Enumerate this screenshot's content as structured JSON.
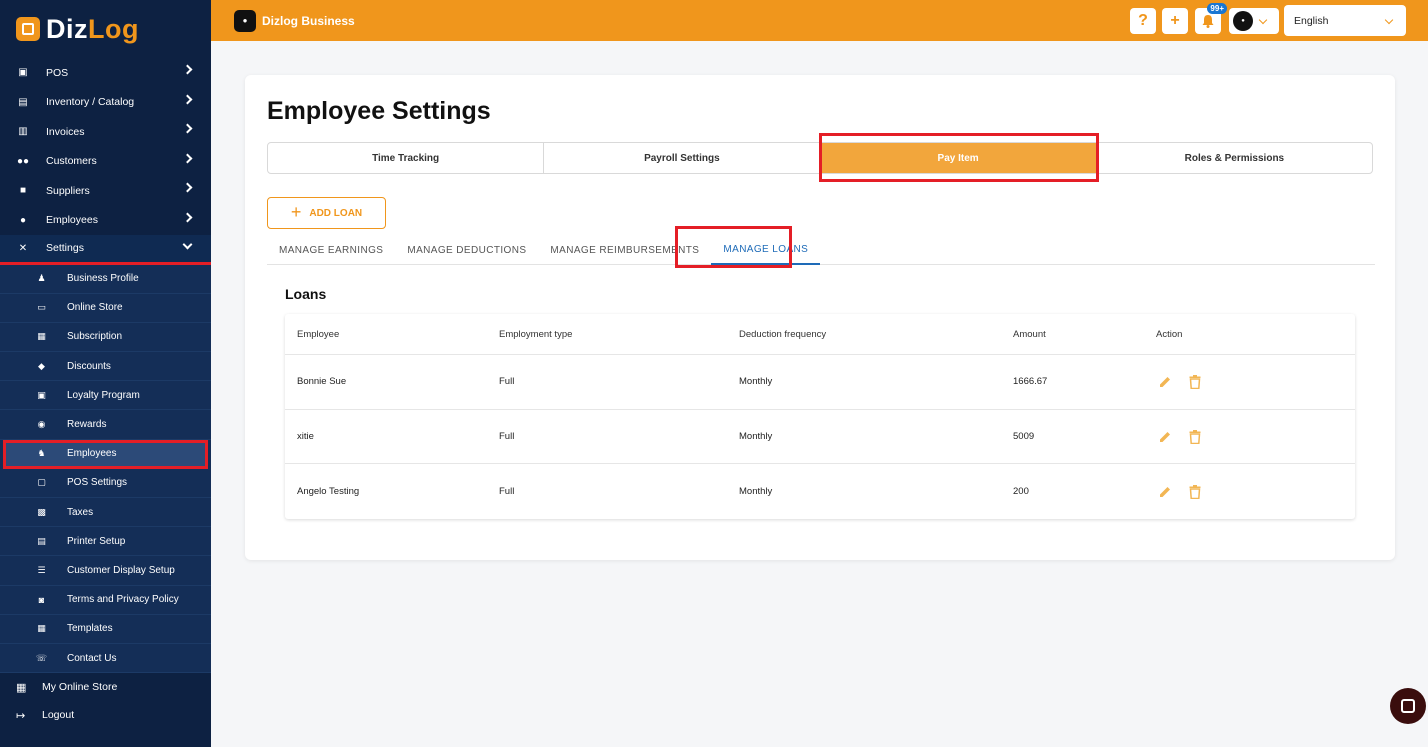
{
  "brand": {
    "part1": "Diz",
    "part2": "Log"
  },
  "sidebar": {
    "items": [
      {
        "label": "POS",
        "icon": "pos-icon"
      },
      {
        "label": "Inventory / Catalog",
        "icon": "inventory-icon"
      },
      {
        "label": "Invoices",
        "icon": "invoice-icon"
      },
      {
        "label": "Customers",
        "icon": "customers-icon"
      },
      {
        "label": "Suppliers",
        "icon": "suppliers-icon"
      },
      {
        "label": "Employees",
        "icon": "employees-icon"
      },
      {
        "label": "Settings",
        "icon": "settings-icon"
      }
    ],
    "settings_sub": [
      {
        "label": "Business Profile"
      },
      {
        "label": "Online Store"
      },
      {
        "label": "Subscription"
      },
      {
        "label": "Discounts"
      },
      {
        "label": "Loyalty Program"
      },
      {
        "label": "Rewards"
      },
      {
        "label": "Employees"
      },
      {
        "label": "POS Settings"
      },
      {
        "label": "Taxes"
      },
      {
        "label": "Printer Setup"
      },
      {
        "label": "Customer Display Setup"
      },
      {
        "label": "Terms and Privacy Policy"
      },
      {
        "label": "Templates"
      },
      {
        "label": "Contact Us"
      }
    ],
    "bottom": [
      {
        "label": "My Online Store"
      },
      {
        "label": "Logout"
      }
    ]
  },
  "topbar": {
    "business_name": "Dizlog Business",
    "help": "?",
    "add": "+",
    "notif_count": "99+",
    "language": "English"
  },
  "page": {
    "title": "Employee Settings",
    "tabs": [
      "Time Tracking",
      "Payroll Settings",
      "Pay Item",
      "Roles & Permissions"
    ],
    "add_loan": "ADD LOAN",
    "subtabs": [
      "MANAGE EARNINGS",
      "MANAGE DEDUCTIONS",
      "MANAGE REIMBURSEMENTS",
      "MANAGE LOANS"
    ],
    "section_title": "Loans"
  },
  "table": {
    "headers": [
      "Employee",
      "Employment type",
      "Deduction frequency",
      "Amount",
      "Action"
    ],
    "rows": [
      {
        "employee": "Bonnie Sue",
        "type": "Full",
        "frequency": "Monthly",
        "amount": "1666.67"
      },
      {
        "employee": "xitie",
        "type": "Full",
        "frequency": "Monthly",
        "amount": "5009"
      },
      {
        "employee": "Angelo Testing",
        "type": "Full",
        "frequency": "Monthly",
        "amount": "200"
      }
    ]
  },
  "colors": {
    "accent": "#f0961c",
    "sidebar": "#0d2142",
    "highlight": "#e41e26",
    "link": "#1e6bb8"
  }
}
